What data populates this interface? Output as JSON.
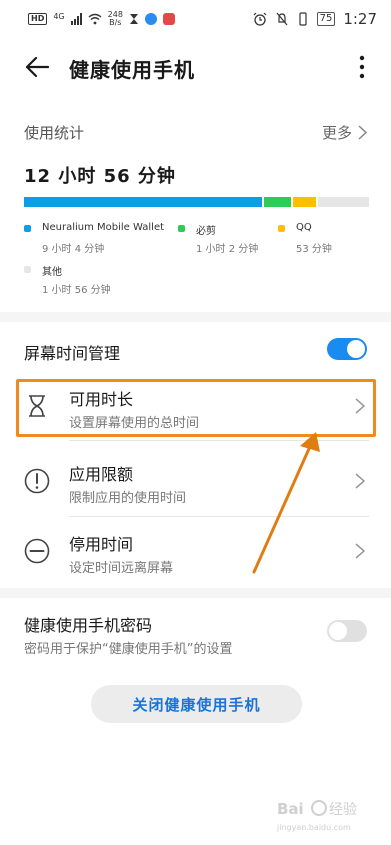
{
  "statusbar": {
    "hd": "HD",
    "signal": "4G",
    "speed_value": "248",
    "speed_unit": "B/s",
    "battery": "75",
    "time": "1:27"
  },
  "header": {
    "title": "健康使用手机"
  },
  "usage": {
    "label": "使用统计",
    "more": "更多",
    "total": "12 小时 56 分钟",
    "apps": [
      {
        "name": "Neuralium Mobile Wallet",
        "time": "9 小时 4 分钟",
        "color": "#0b9ee9",
        "fraction": 0.701
      },
      {
        "name": "必剪",
        "time": "1 小时 2 分钟",
        "color": "#2ecb56",
        "fraction": 0.08
      },
      {
        "name": "QQ",
        "time": "53 分钟",
        "color": "#ffbe00",
        "fraction": 0.068
      },
      {
        "name": "其他",
        "time": "1 小时 56 分钟",
        "color": "#e6e6e6",
        "fraction": 0.15
      }
    ]
  },
  "management": {
    "title": "屏幕时间管理",
    "toggle_on": true,
    "accent": "#1a8cf0",
    "rows": [
      {
        "title": "可用时长",
        "subtitle": "设置屏幕使用的总时间",
        "icon": "hourglass-icon"
      },
      {
        "title": "应用限额",
        "subtitle": "限制应用的使用时间",
        "icon": "exclamation-circle-icon"
      },
      {
        "title": "停用时间",
        "subtitle": "设定时间远离屏幕",
        "icon": "minus-circle-icon"
      }
    ]
  },
  "password": {
    "title": "健康使用手机密码",
    "description": "密码用于保护“健康使用手机”的设置",
    "toggle_on": false
  },
  "close_button": "关闭健康使用手机",
  "watermark": {
    "brand": "Baidu经验",
    "url": "jingyan.baidu.com"
  },
  "annotation_color": "#f08a1c"
}
